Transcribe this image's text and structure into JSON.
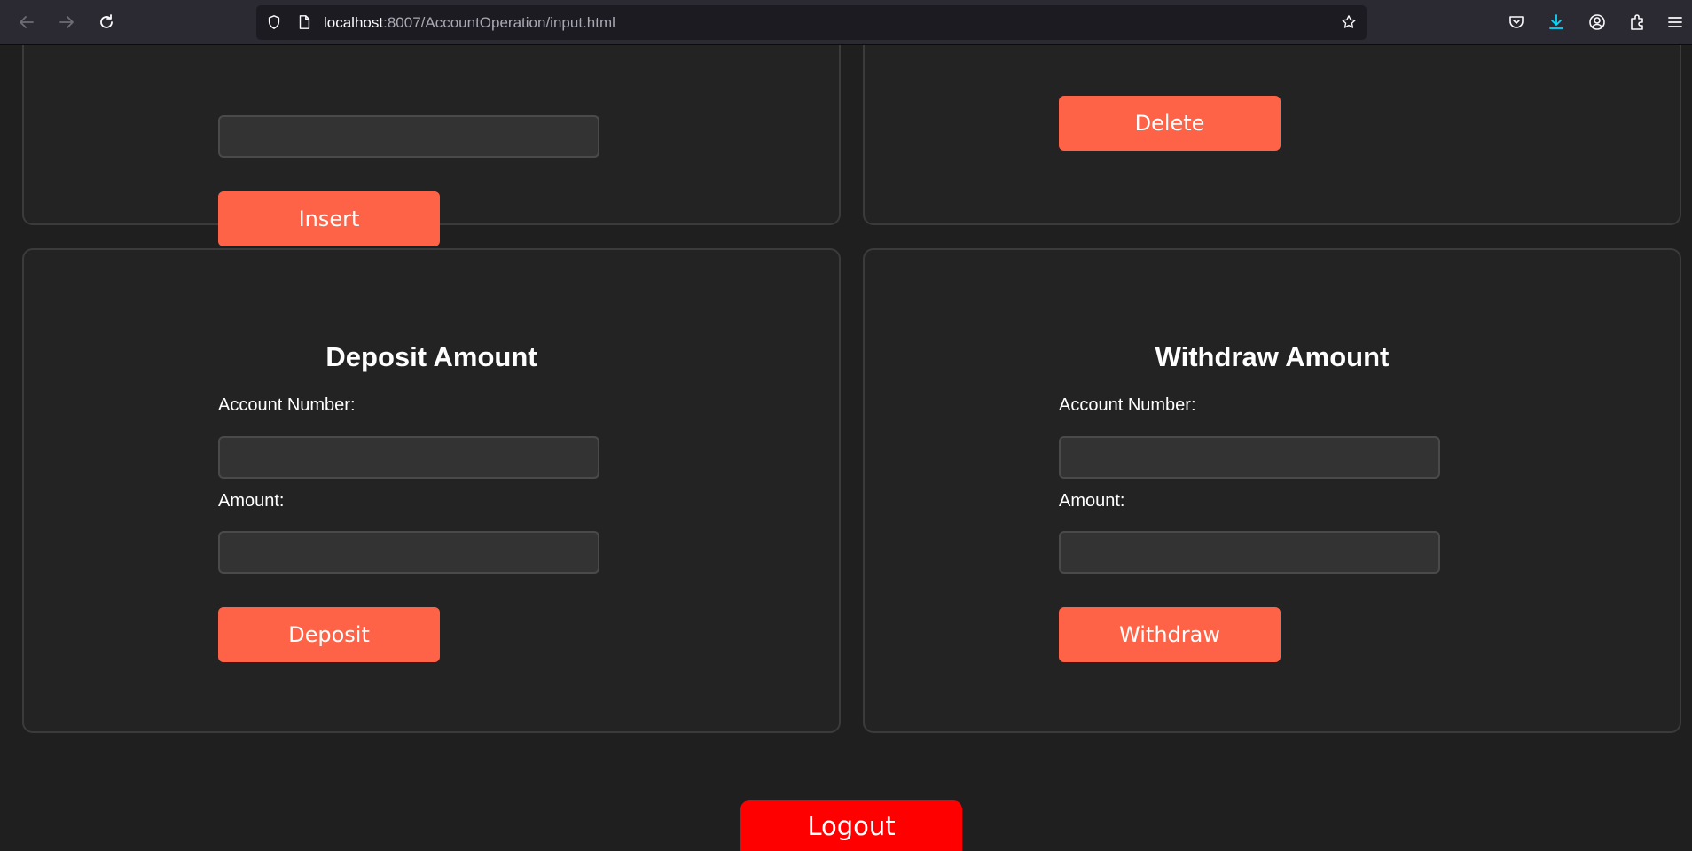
{
  "browser": {
    "url_host": "localhost",
    "url_path": ":8007/AccountOperation/input.html"
  },
  "insert_card": {
    "button_label": "Insert"
  },
  "delete_card": {
    "button_label": "Delete"
  },
  "deposit_card": {
    "title": "Deposit Amount",
    "account_label": "Account Number:",
    "account_value": "",
    "amount_label": "Amount:",
    "amount_value": "",
    "button_label": "Deposit"
  },
  "withdraw_card": {
    "title": "Withdraw Amount",
    "account_label": "Account Number:",
    "account_value": "",
    "amount_label": "Amount:",
    "amount_value": "",
    "button_label": "Withdraw"
  },
  "logout": {
    "label": "Logout"
  },
  "colors": {
    "accent_button": "#ff6347",
    "logout_button": "#ff0000",
    "downloads_icon": "#00ddff",
    "page_background": "#1f1f1f",
    "card_background": "#232323"
  },
  "icons": [
    "back-icon",
    "forward-icon",
    "reload-icon",
    "shield-icon",
    "page-icon",
    "bookmark-star-icon",
    "pocket-icon",
    "download-icon",
    "account-icon",
    "extensions-icon",
    "menu-icon"
  ]
}
